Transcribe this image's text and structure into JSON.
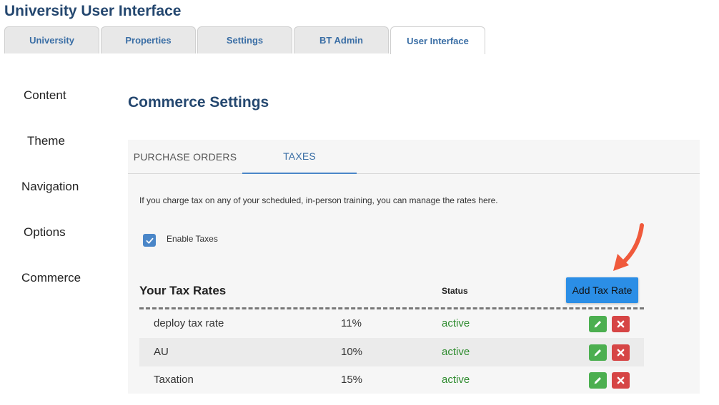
{
  "header": {
    "title": "University User Interface"
  },
  "top_tabs": [
    {
      "label": "University",
      "active": false
    },
    {
      "label": "Properties",
      "active": false
    },
    {
      "label": "Settings",
      "active": false
    },
    {
      "label": "BT Admin",
      "active": false
    },
    {
      "label": "User Interface",
      "active": true
    }
  ],
  "sidebar": {
    "items": [
      {
        "label": "Content"
      },
      {
        "label": "Theme"
      },
      {
        "label": "Navigation"
      },
      {
        "label": "Options"
      },
      {
        "label": "Commerce"
      }
    ]
  },
  "main": {
    "title": "Commerce Settings",
    "sub_tabs": [
      {
        "label": "PURCHASE ORDERS",
        "active": false
      },
      {
        "label": "TAXES",
        "active": true
      }
    ],
    "info_text": "If you charge tax on any of your scheduled, in-person training, you can manage the rates here.",
    "enable_taxes": {
      "label": "Enable Taxes",
      "checked": true
    },
    "rates": {
      "heading": "Your Tax Rates",
      "status_header": "Status",
      "add_button": "Add Tax Rate",
      "rows": [
        {
          "name": "deploy tax rate",
          "rate": "11%",
          "status": "active"
        },
        {
          "name": "AU",
          "rate": "10%",
          "status": "active"
        },
        {
          "name": "Taxation",
          "rate": "15%",
          "status": "active"
        }
      ]
    }
  },
  "icons": {
    "edit": "pencil-icon",
    "delete": "x-icon",
    "check": "checkmark-icon",
    "annotation": "red-arrow-icon"
  },
  "colors": {
    "title": "#24476f",
    "tab_text": "#3a6ea5",
    "primary_button": "#2b8ee6",
    "status_active": "#2e8b2e",
    "edit_button": "#4caf50",
    "delete_button": "#d64545",
    "annotation_arrow": "#f05a3c"
  }
}
